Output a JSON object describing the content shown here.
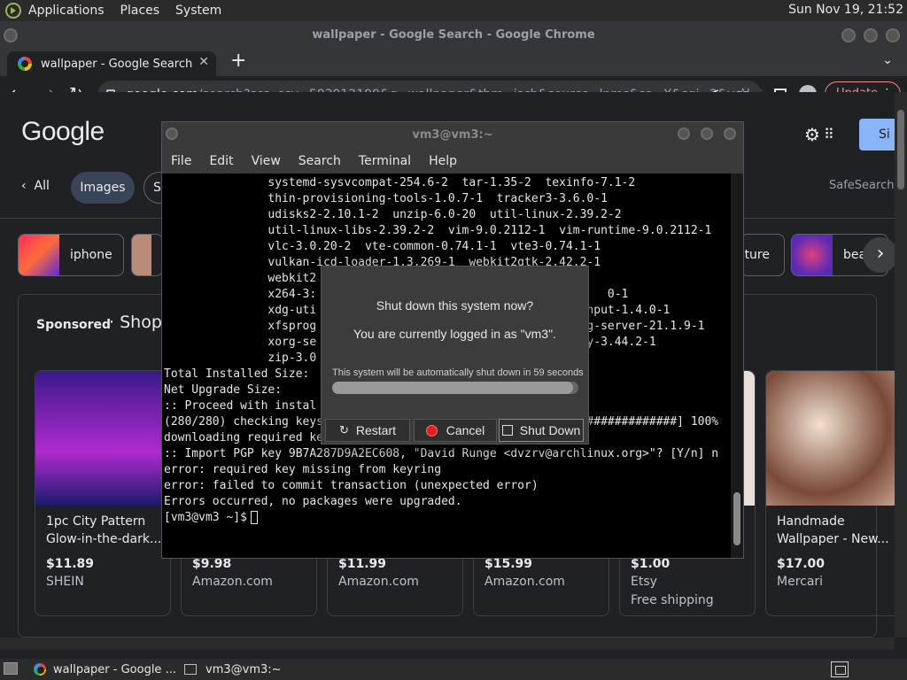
{
  "top_panel": {
    "menus": [
      "Applications",
      "Places",
      "System"
    ],
    "clock": "Sun Nov 19, 21:52"
  },
  "chrome": {
    "window_title": "wallpaper - Google Search - Google Chrome",
    "tab_title": "wallpaper - Google Search",
    "url_host": "google.com",
    "url_path": "/search?sca_esv=583912199&q=wallpaper&tbm=isch&source=lnms&sa=X&sqi=2&ved=2ah...",
    "update_label": "Update"
  },
  "google": {
    "logo": "Google",
    "signin_partial": "Si",
    "nav_back": "All",
    "nav_images": "Images",
    "nav_partial": "S",
    "safesearch": "SafeSearch",
    "chips": [
      {
        "label": "iphone",
        "color": "#e8335f"
      },
      {
        "label": "",
        "color": "#b98c7a"
      },
      {
        "label": "ture",
        "color": "#555"
      },
      {
        "label": "bea",
        "color": "#c02c6a"
      }
    ],
    "sponsored": "Sponsored",
    "shop_title": "Shop w",
    "cards": [
      {
        "name1": "1pc City Pattern",
        "name2": "Glow-in-the-dark...",
        "price": "$11.89",
        "store": "SHEIN",
        "shipping": "",
        "color": "#5b2bb5"
      },
      {
        "name1": "",
        "name2": "",
        "price": "$9.98",
        "store": "Amazon.com",
        "shipping": "",
        "color": "#202124"
      },
      {
        "name1": "",
        "name2": "",
        "price": "$11.99",
        "store": "Amazon.com",
        "shipping": "",
        "color": "#202124"
      },
      {
        "name1": "",
        "name2": "",
        "price": "$15.99",
        "store": "Amazon.com",
        "shipping": "",
        "color": "#202124"
      },
      {
        "name1": "",
        "name2": "",
        "price": "$1.00",
        "store": "Etsy",
        "shipping": "Free shipping",
        "color": "#e8e0d8"
      },
      {
        "name1": "Handmade",
        "name2": "Wallpaper - New...",
        "price": "$17.00",
        "store": "Mercari",
        "shipping": "",
        "color": "#c8a894"
      }
    ]
  },
  "terminal": {
    "title": "vm3@vm3:~",
    "menus": [
      "File",
      "Edit",
      "View",
      "Search",
      "Terminal",
      "Help"
    ],
    "lines": [
      "               systemd-sysvcompat-254.6-2  tar-1.35-2  texinfo-7.1-2",
      "               thin-provisioning-tools-1.0.7-1  tracker3-3.6.0-1",
      "               udisks2-2.10.1-2  unzip-6.0-20  util-linux-2.39.2-2",
      "               util-linux-libs-2.39.2-2  vim-9.0.2112-1  vim-runtime-9.0.2112-1",
      "               vlc-3.0.20-2  vte-common-0.74.1-1  vte3-0.74.1-1",
      "               vulkan-icd-loader-1.3.269-1  webkit2gtk-2.42.2-1",
      "               webkit2",
      "               x264-3:                                          0-1",
      "               xdg-uti                                      input-1.4.0-1",
      "               xfsprog                                      rg-server-21.1.9-1",
      "               xorg-se                                      ty-3.44.2-1",
      "               zip-3.0",
      "",
      "Total Installed Size:",
      "Net Upgrade Size:",
      "",
      ":: Proceed with instal",
      "(280/280) checking keys in keyring                 [######################] 100%",
      "downloading required keys...",
      ":: Import PGP key 9B7A287D9A2EC608, \"David Runge <dvzrv@archlinux.org>\"? [Y/n] n",
      "error: required key missing from keyring",
      "error: failed to commit transaction (unexpected error)",
      "Errors occurred, no packages were upgraded."
    ],
    "prompt": "[vm3@vm3 ~]$"
  },
  "dialog": {
    "question": "Shut down this system now?",
    "logged_in": "You are currently logged in as \"vm3\".",
    "auto_msg": "This system will be automatically shut down in 59 seconds",
    "progress": 0.98,
    "restart": "Restart",
    "cancel": "Cancel",
    "shutdown": "Shut Down"
  },
  "taskbar": {
    "chrome_item": "wallpaper - Google ...",
    "terminal_item": "vm3@vm3:~"
  }
}
